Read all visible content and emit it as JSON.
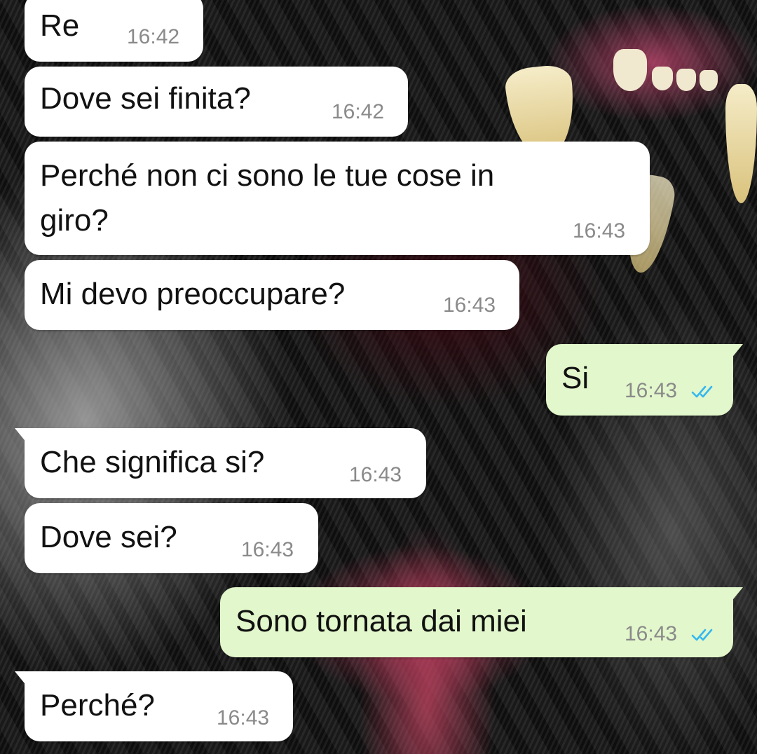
{
  "wallpaper": {
    "description_icon": "tiger-wallpaper"
  },
  "messages": [
    {
      "id": "m1",
      "direction": "in",
      "text": "Re",
      "time": "16:42"
    },
    {
      "id": "m2",
      "direction": "in",
      "text": "Dove sei finita?",
      "time": "16:42"
    },
    {
      "id": "m3",
      "direction": "in",
      "text_line1": "Perché non ci sono le tue cose in",
      "text_line2": "giro?",
      "time": "16:43"
    },
    {
      "id": "m4",
      "direction": "in",
      "text": "Mi devo preoccupare?",
      "time": "16:43"
    },
    {
      "id": "m5",
      "direction": "out",
      "text": "Si",
      "time": "16:43",
      "status_icon": "double-check-read-icon"
    },
    {
      "id": "m6",
      "direction": "in",
      "text": "Che significa si?",
      "time": "16:43"
    },
    {
      "id": "m7",
      "direction": "in",
      "text": "Dove sei?",
      "time": "16:43"
    },
    {
      "id": "m8",
      "direction": "out",
      "text": "Sono tornata dai miei",
      "time": "16:43",
      "status_icon": "double-check-read-icon"
    },
    {
      "id": "m9",
      "direction": "in",
      "text": "Perché?",
      "time": "16:43"
    }
  ],
  "colors": {
    "incoming_bubble": "#ffffff",
    "outgoing_bubble": "#e2f7cb",
    "timestamp": "#8a8a8a",
    "read_ticks": "#34b7f1"
  }
}
